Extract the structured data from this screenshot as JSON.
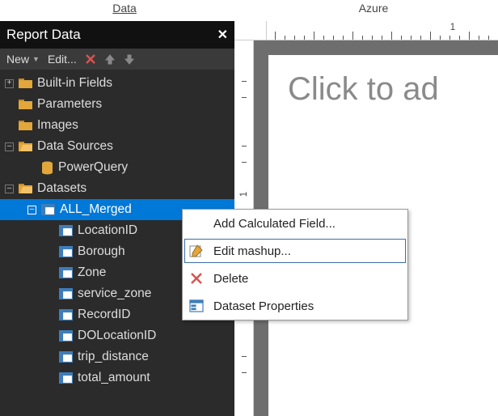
{
  "top_menus": {
    "left": "Data",
    "right": "Azure"
  },
  "panel": {
    "title": "Report Data"
  },
  "toolbar": {
    "new": "New",
    "edit": "Edit..."
  },
  "tree": {
    "builtin": "Built-in Fields",
    "parameters": "Parameters",
    "images": "Images",
    "datasources": "Data Sources",
    "powerquery": "PowerQuery",
    "datasets": "Datasets",
    "all_merged": "ALL_Merged",
    "fields": [
      "LocationID",
      "Borough",
      "Zone",
      "service_zone",
      "RecordID",
      "DOLocationID",
      "trip_distance",
      "total_amount"
    ]
  },
  "ruler": {
    "mark": "1"
  },
  "canvas": {
    "placeholder": "Click to ad"
  },
  "ctx": {
    "add_calc": "Add Calculated Field...",
    "edit_mashup": "Edit mashup...",
    "delete": "Delete",
    "props": "Dataset Properties"
  }
}
